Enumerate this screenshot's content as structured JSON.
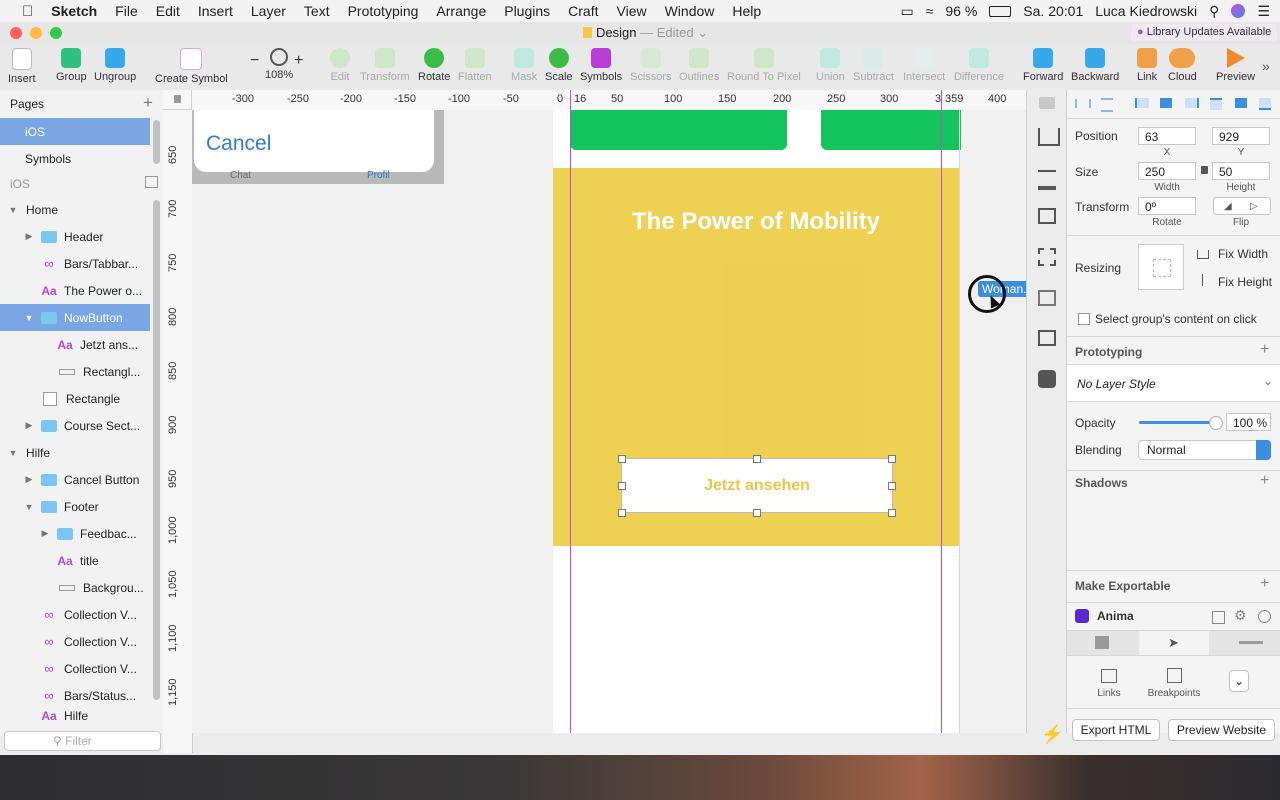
{
  "menubar": {
    "app": "Sketch",
    "items": [
      "File",
      "Edit",
      "Insert",
      "Layer",
      "Text",
      "Prototyping",
      "Arrange",
      "Plugins",
      "Craft",
      "View",
      "Window",
      "Help"
    ],
    "battery": "96 %",
    "clock": "Sa. 20:01",
    "user": "Luca Kiedrowski"
  },
  "window": {
    "doc_title": "Design",
    "doc_status": "— Edited",
    "library_notice": "Library Updates Available"
  },
  "toolbar": {
    "insert": "Insert",
    "group": "Group",
    "ungroup": "Ungroup",
    "create_symbol": "Create Symbol",
    "zoom_minus": "−",
    "zoom_plus": "+",
    "zoom": "108%",
    "edit": "Edit",
    "transform": "Transform",
    "rotate": "Rotate",
    "flatten": "Flatten",
    "mask": "Mask",
    "scale": "Scale",
    "symbols": "Symbols",
    "scissors": "Scissors",
    "outlines": "Outlines",
    "round": "Round To Pixel",
    "union": "Union",
    "subtract": "Subtract",
    "intersect": "Intersect",
    "difference": "Difference",
    "forward": "Forward",
    "backward": "Backward",
    "link": "Link",
    "cloud": "Cloud",
    "preview": "Preview"
  },
  "sidebar": {
    "pages_label": "Pages",
    "pages": [
      "iOS",
      "Symbols"
    ],
    "current_page": "iOS",
    "filter_placeholder": "Filter",
    "layers": [
      {
        "label": "Home",
        "kind": "group-open"
      },
      {
        "label": "Header",
        "kind": "folder"
      },
      {
        "label": "Bars/Tabbar...",
        "kind": "symbol"
      },
      {
        "label": "The Power o...",
        "kind": "text"
      },
      {
        "label": "NowButton",
        "kind": "folder-open"
      },
      {
        "label": "Jetzt ans...",
        "kind": "text"
      },
      {
        "label": "Rectangl...",
        "kind": "line"
      },
      {
        "label": "Rectangle",
        "kind": "rect"
      },
      {
        "label": "Course Sect...",
        "kind": "folder"
      },
      {
        "label": "Hilfe",
        "kind": "group-open"
      },
      {
        "label": "Cancel Button",
        "kind": "folder"
      },
      {
        "label": "Footer",
        "kind": "folder-open"
      },
      {
        "label": "Feedbac...",
        "kind": "folder"
      },
      {
        "label": "title",
        "kind": "text"
      },
      {
        "label": "Backgrou...",
        "kind": "line"
      },
      {
        "label": "Collection V...",
        "kind": "symbol"
      },
      {
        "label": "Collection V...",
        "kind": "symbol"
      },
      {
        "label": "Collection V...",
        "kind": "symbol"
      },
      {
        "label": "Bars/Status...",
        "kind": "symbol"
      },
      {
        "label": "Hilfe",
        "kind": "text"
      }
    ]
  },
  "ruler": {
    "h": [
      "-300",
      "-250",
      "-200",
      "-150",
      "-100",
      "-50",
      "0",
      "16",
      "50",
      "100",
      "150",
      "200",
      "250",
      "300",
      "3",
      "359",
      "400"
    ],
    "v": [
      "650",
      "700",
      "750",
      "800",
      "850",
      "900",
      "950",
      "1,000",
      "1,050",
      "1,100",
      "1,150"
    ]
  },
  "canvas": {
    "cancel_label": "Cancel",
    "tab_chat": "Chat",
    "tab_profil": "Profil",
    "hero_title": "The Power of Mobility",
    "cta_label": "Jetzt ansehen",
    "drag_label": "Woman.svg",
    "hero_color": "#eed053",
    "green_color": "#14c35c",
    "accent_text": "#e9c64b"
  },
  "inspector": {
    "position_label": "Position",
    "x": "63",
    "y": "929",
    "x_label": "X",
    "y_label": "Y",
    "size_label": "Size",
    "width": "250",
    "height": "50",
    "width_label": "Width",
    "height_label": "Height",
    "transform_label": "Transform",
    "rotate_value": "0º",
    "rotate_label": "Rotate",
    "flip_label": "Flip",
    "resizing_label": "Resizing",
    "fix_width": "Fix Width",
    "fix_height": "Fix Height",
    "select_group": "Select group's content on click",
    "prototyping": "Prototyping",
    "layer_style": "No Layer Style",
    "opacity_label": "Opacity",
    "opacity_value": "100 %",
    "opacity": 1.0,
    "blending_label": "Blending",
    "blending_value": "Normal",
    "shadows": "Shadows",
    "make_exportable": "Make Exportable",
    "anima": "Anima",
    "links": "Links",
    "breakpoints": "Breakpoints",
    "export_html": "Export HTML",
    "preview_website": "Preview Website"
  }
}
